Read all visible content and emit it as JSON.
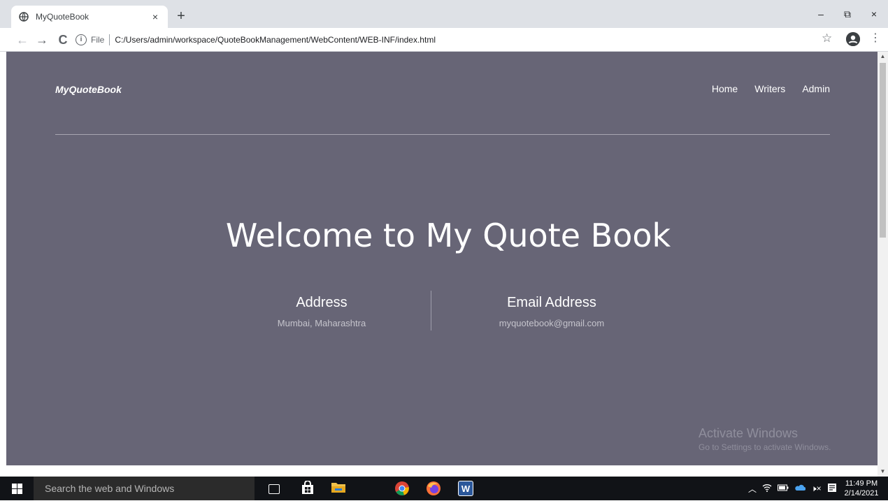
{
  "browser": {
    "tab_title": "MyQuoteBook",
    "tab_close": "×",
    "new_tab": "+",
    "window_controls": [
      "–",
      "⧉",
      "×"
    ],
    "back": "←",
    "forward": "→",
    "reload": "C",
    "info_icon": "i",
    "scheme": "File",
    "url": "C:/Users/admin/workspace/QuoteBookManagement/WebContent/WEB-INF/index.html",
    "bookmark": "☆",
    "menu": "⋮"
  },
  "site": {
    "brand": "MyQuoteBook",
    "nav": [
      "Home",
      "Writers",
      "Admin"
    ],
    "hero_title": "Welcome to My Quote Book",
    "contacts": [
      {
        "label": "Address",
        "value": "Mumbai, Maharashtra"
      },
      {
        "label": "Email Address",
        "value": "myquotebook@gmail.com"
      }
    ],
    "background_color": "#676576"
  },
  "watermark": {
    "line1": "Activate Windows",
    "line2": "Go to Settings to activate Windows."
  },
  "taskbar": {
    "search_placeholder": "Search the web and Windows",
    "time": "11:49 PM",
    "date": "2/14/2021",
    "tray_icons": [
      "chevron-up-icon",
      "wifi-icon",
      "battery-icon",
      "onedrive-icon",
      "volume-muted-icon",
      "notification-icon"
    ],
    "apps": [
      "task-view-icon",
      "store-icon",
      "file-explorer-icon",
      "chrome-icon",
      "firefox-icon",
      "word-icon"
    ]
  }
}
